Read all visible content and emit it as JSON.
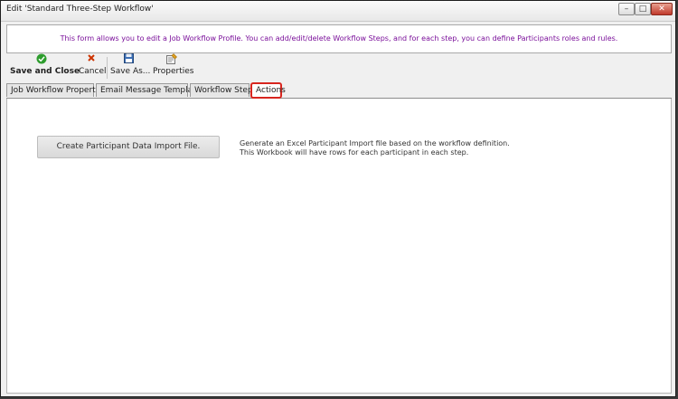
{
  "window": {
    "title": "Edit 'Standard Three-Step Workflow'",
    "controls": {
      "minimize": "–",
      "maximize": "□",
      "close": "✕"
    }
  },
  "info": {
    "text": "This form allows you to edit a Job Workflow Profile. You can add/edit/delete Workflow Steps, and for each step, you can define Participants roles and rules."
  },
  "toolbar": {
    "save_close_label": "Save and Close",
    "cancel_label": "Cancel",
    "save_as_label": "Save As...",
    "properties_label": "Properties",
    "icons": {
      "save_close": "check-circle-icon",
      "cancel": "x-icon",
      "save_as": "floppy-disk-icon",
      "properties": "properties-icon"
    }
  },
  "tabs": [
    {
      "label": "Job Workflow Properties"
    },
    {
      "label": "Email Message Template"
    },
    {
      "label": "Workflow Steps"
    },
    {
      "label": "Actions",
      "selected": true
    }
  ],
  "actions": {
    "button_label": "Create Participant Data Import File.",
    "description_line1": "Generate an Excel Participant Import file based on the workflow definition.",
    "description_line2": "This Workbook will have rows for each participant in each step."
  },
  "colors": {
    "info_text": "#7a0f9a",
    "tab_highlight": "#d8261f",
    "check_green": "#2e9d2e",
    "cancel_red": "#cc3300"
  }
}
